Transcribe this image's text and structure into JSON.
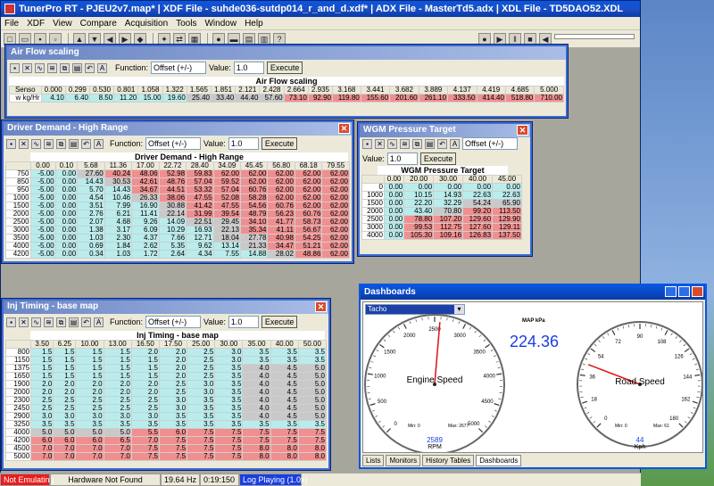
{
  "app": {
    "title": "TunerPro RT - PJEU2v7.map* | XDF File - suhde036-sutdp014_r_and_d.xdf* | ADX File - MasterTd5.adx | XDL File - TD5DAO52.XDL"
  },
  "menu": [
    "File",
    "XDF",
    "View",
    "Compare",
    "Acquisition",
    "Tools",
    "Window",
    "Help"
  ],
  "common": {
    "function_label": "Function:",
    "function_value": "Offset (+/-)",
    "value_label": "Value:",
    "value": "1.0",
    "execute": "Execute"
  },
  "airflow": {
    "window_title": "Air Flow  scaling",
    "table_title": "Air Flow  scaling",
    "row1_label": "Senso",
    "row2_label": "w kg/Hr",
    "cols": [
      "0.000",
      "0.299",
      "0.530",
      "0.801",
      "1.058",
      "1.322",
      "1.565",
      "1.851",
      "2.121",
      "2.428",
      "2.664",
      "2.935",
      "3.168",
      "3.441",
      "3.682",
      "3.889",
      "4.137",
      "4.419",
      "4.685",
      "5.000"
    ],
    "vals": [
      "4.10",
      "6.40",
      "8.50",
      "11.20",
      "15.00",
      "19.60",
      "25.40",
      "33.40",
      "44.40",
      "57.60",
      "73.10",
      "92.90",
      "119.80",
      "155.60",
      "201.60",
      "261.10",
      "333.50",
      "414.40",
      "518.80",
      "710.00"
    ]
  },
  "driver": {
    "window_title": "Driver Demand - High Range",
    "table_title": "Driver Demand - High Range",
    "cols": [
      "0.00",
      "0.10",
      "5.68",
      "11.36",
      "17.00",
      "22.72",
      "28.40",
      "34.09",
      "45.45",
      "56.80",
      "68.18",
      "79.55"
    ],
    "rows": [
      {
        "h": "750",
        "v": [
          "-5.00",
          "0.00",
          "27.60",
          "40.24",
          "48.06",
          "52.98",
          "59.83",
          "62.00",
          "62.00",
          "62.00",
          "62.00",
          "62.00"
        ]
      },
      {
        "h": "850",
        "v": [
          "-5.00",
          "0.00",
          "14.43",
          "30.53",
          "42.61",
          "48.76",
          "57.04",
          "59.52",
          "62.00",
          "62.00",
          "62.00",
          "62.00"
        ]
      },
      {
        "h": "950",
        "v": [
          "-5.00",
          "0.00",
          "5.70",
          "14.43",
          "34.67",
          "44.51",
          "53.32",
          "57.04",
          "60.76",
          "62.00",
          "62.00",
          "62.00"
        ]
      },
      {
        "h": "1000",
        "v": [
          "-5.00",
          "0.00",
          "4.54",
          "10.46",
          "26.33",
          "38.06",
          "47.55",
          "52.08",
          "58.28",
          "62.00",
          "62.00",
          "62.00"
        ]
      },
      {
        "h": "1500",
        "v": [
          "-5.00",
          "0.00",
          "3.51",
          "7.99",
          "16.90",
          "30.88",
          "41.42",
          "47.55",
          "54.56",
          "60.76",
          "62.00",
          "62.00"
        ]
      },
      {
        "h": "2000",
        "v": [
          "-5.00",
          "0.00",
          "2.76",
          "6.21",
          "11.41",
          "22.14",
          "31.99",
          "39.54",
          "48.79",
          "56.23",
          "60.76",
          "62.00"
        ]
      },
      {
        "h": "2500",
        "v": [
          "-5.00",
          "0.00",
          "2.07",
          "4.68",
          "9.26",
          "14.09",
          "22.51",
          "29.45",
          "34.10",
          "41.77",
          "58.73",
          "62.00"
        ]
      },
      {
        "h": "3000",
        "v": [
          "-5.00",
          "0.00",
          "1.38",
          "3.17",
          "6.09",
          "10.29",
          "16.93",
          "22.13",
          "35.34",
          "41.11",
          "56.67",
          "62.00"
        ]
      },
      {
        "h": "3500",
        "v": [
          "-5.00",
          "0.00",
          "1.03",
          "2.30",
          "4.37",
          "7.66",
          "12.71",
          "18.04",
          "27.78",
          "40.98",
          "54.25",
          "62.00"
        ]
      },
      {
        "h": "4000",
        "v": [
          "-5.00",
          "0.00",
          "0.69",
          "1.84",
          "2.62",
          "5.35",
          "9.62",
          "13.14",
          "21.33",
          "34.47",
          "51.21",
          "62.00"
        ]
      },
      {
        "h": "4200",
        "v": [
          "-5.00",
          "0.00",
          "0.34",
          "1.03",
          "1.72",
          "2.64",
          "4.34",
          "7.55",
          "14.88",
          "28.02",
          "48.86",
          "62.00"
        ]
      }
    ]
  },
  "wgm": {
    "window_title": "WGM Pressure Target",
    "table_title": "WGM Pressure Target",
    "cols": [
      "0.00",
      "20.00",
      "30.00",
      "40.00",
      "45.00"
    ],
    "rows": [
      {
        "h": "0",
        "v": [
          "0.00",
          "0.00",
          "0.00",
          "0.00",
          "0.00"
        ]
      },
      {
        "h": "1000",
        "v": [
          "0.00",
          "10.15",
          "14.93",
          "22.63",
          "22.63"
        ]
      },
      {
        "h": "1500",
        "v": [
          "0.00",
          "22.20",
          "32.29",
          "54.24",
          "65.90"
        ]
      },
      {
        "h": "2000",
        "v": [
          "0.00",
          "43.40",
          "70.80",
          "99.20",
          "113.50"
        ]
      },
      {
        "h": "2500",
        "v": [
          "0.00",
          "78.80",
          "107.20",
          "129.60",
          "129.90"
        ]
      },
      {
        "h": "3000",
        "v": [
          "0.00",
          "99.53",
          "112.75",
          "127.60",
          "129.11"
        ]
      },
      {
        "h": "4000",
        "v": [
          "0.00",
          "105.30",
          "109.16",
          "126.83",
          "137.50"
        ]
      }
    ]
  },
  "inj": {
    "window_title": "Inj Timing - base map",
    "table_title": "Inj Timing - base map",
    "cols": [
      "3.50",
      "6.25",
      "10.00",
      "13.00",
      "16.50",
      "17.50",
      "25.00",
      "30.00",
      "35.00",
      "40.00",
      "50.00"
    ],
    "rows": [
      {
        "h": "800",
        "v": [
          "1.5",
          "1.5",
          "1.5",
          "1.5",
          "2.0",
          "2.0",
          "2.5",
          "3.0",
          "3.5",
          "3.5",
          "3.5"
        ]
      },
      {
        "h": "1150",
        "v": [
          "1.5",
          "1.5",
          "1.5",
          "1.5",
          "1.5",
          "2.0",
          "2.5",
          "3.0",
          "3.5",
          "3.5",
          "3.5"
        ]
      },
      {
        "h": "1375",
        "v": [
          "1.5",
          "1.5",
          "1.5",
          "1.5",
          "1.5",
          "2.0",
          "2.5",
          "3.5",
          "4.0",
          "4.5",
          "5.0"
        ]
      },
      {
        "h": "1650",
        "v": [
          "1.5",
          "1.5",
          "1.5",
          "1.5",
          "1.5",
          "2.0",
          "2.5",
          "3.5",
          "4.0",
          "4.5",
          "5.0"
        ]
      },
      {
        "h": "1900",
        "v": [
          "2.0",
          "2.0",
          "2.0",
          "2.0",
          "2.0",
          "2.5",
          "3.0",
          "3.5",
          "4.0",
          "4.5",
          "5.0"
        ]
      },
      {
        "h": "2000",
        "v": [
          "2.0",
          "2.0",
          "2.0",
          "2.0",
          "2.0",
          "2.5",
          "3.0",
          "3.5",
          "4.0",
          "4.5",
          "5.0"
        ]
      },
      {
        "h": "2300",
        "v": [
          "2.5",
          "2.5",
          "2.5",
          "2.5",
          "2.5",
          "3.0",
          "3.5",
          "3.5",
          "4.0",
          "4.5",
          "5.0"
        ]
      },
      {
        "h": "2450",
        "v": [
          "2.5",
          "2.5",
          "2.5",
          "2.5",
          "2.5",
          "3.0",
          "3.5",
          "3.5",
          "4.0",
          "4.5",
          "5.0"
        ]
      },
      {
        "h": "2900",
        "v": [
          "3.0",
          "3.0",
          "3.0",
          "3.0",
          "3.0",
          "3.5",
          "3.5",
          "3.5",
          "4.0",
          "4.5",
          "5.0"
        ]
      },
      {
        "h": "3250",
        "v": [
          "3.5",
          "3.5",
          "3.5",
          "3.5",
          "3.5",
          "3.5",
          "3.5",
          "3.5",
          "3.5",
          "3.5",
          "3.5"
        ]
      },
      {
        "h": "4000",
        "v": [
          "5.0",
          "5.0",
          "5.0",
          "5.0",
          "5.5",
          "6.0",
          "7.5",
          "7.5",
          "7.5",
          "7.5",
          "7.5"
        ]
      },
      {
        "h": "4200",
        "v": [
          "6.0",
          "6.0",
          "6.0",
          "6.5",
          "7.0",
          "7.5",
          "7.5",
          "7.5",
          "7.5",
          "7.5",
          "7.5"
        ]
      },
      {
        "h": "4500",
        "v": [
          "7.0",
          "7.0",
          "7.0",
          "7.0",
          "7.5",
          "7.5",
          "7.5",
          "7.5",
          "8.0",
          "8.0",
          "8.0"
        ]
      },
      {
        "h": "5000",
        "v": [
          "7.0",
          "7.0",
          "7.0",
          "7.0",
          "7.5",
          "7.5",
          "7.5",
          "7.5",
          "8.0",
          "8.0",
          "8.0"
        ]
      }
    ]
  },
  "dash": {
    "window_title": "Dashboards",
    "dropdown": "Tacho",
    "map_label": "MAP kPa",
    "map_value": "224.36",
    "engine": {
      "title": "Engine Speed",
      "value": "2589",
      "unit": "RPM",
      "min": "Min: 0",
      "max": "Max: 2677",
      "ticks": [
        "0",
        "500",
        "1000",
        "1500",
        "2000",
        "2500",
        "3000",
        "3500",
        "4000",
        "4500",
        "5000"
      ],
      "needle": 2589
    },
    "road": {
      "title": "Road Speed",
      "value": "44",
      "unit": "Kph",
      "min": "Min: 0",
      "max": "Max: 61",
      "ticks": [
        "0",
        "18",
        "36",
        "54",
        "72",
        "90",
        "108",
        "126",
        "144",
        "162",
        "180"
      ],
      "needle": 44
    },
    "tabs": [
      "Lists",
      "Monitors",
      "History Tables",
      "Dashboards"
    ]
  },
  "status": {
    "emu": "Not Emulating",
    "hw": "Hardware Not Found",
    "hz": "19.64 Hz",
    "time": "0:19:150",
    "log": "Log Playing (1.0x)"
  },
  "colors": {
    "cyan": "#b9ecec",
    "red": "#f08f8f",
    "grey": "#c9c9c9",
    "emu": "#e61e1e",
    "log": "#1a3ee0"
  }
}
